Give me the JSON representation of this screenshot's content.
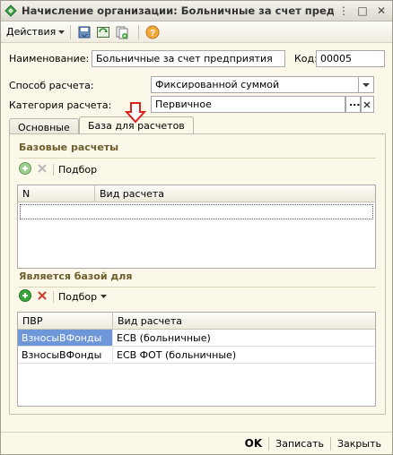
{
  "window": {
    "title": "Начисление организации: Больничные за счет предприя",
    "controls": [
      "⋮",
      "□",
      "✕"
    ]
  },
  "toolbar": {
    "actions_label": "Действия",
    "icons": [
      "save-and-close-icon",
      "refresh-icon",
      "copy-icon",
      "help-icon"
    ]
  },
  "form": {
    "name_label": "Наименование:",
    "name_value": "Больничные за счет предприятия",
    "code_label": "Код:",
    "code_value": "00005",
    "method_label": "Способ расчета:",
    "method_value": "Фиксированной суммой",
    "category_label": "Категория расчета:",
    "category_value": "Первичное"
  },
  "tabs": [
    {
      "label": "Основные",
      "active": false
    },
    {
      "label": "База для расчетов",
      "active": true
    }
  ],
  "base_section": {
    "title": "Базовые расчеты",
    "select_label": "Подбор",
    "columns": [
      "N",
      "Вид расчета"
    ],
    "rows": []
  },
  "is_base_section": {
    "title": "Является базой для",
    "select_label": "Подбор",
    "columns": [
      "ПВР",
      "Вид расчета"
    ],
    "rows": [
      {
        "pvr": "ВзносыВФонды",
        "kind": "ЕСВ (больничные)"
      },
      {
        "pvr": "ВзносыВФонды",
        "kind": "ЕСВ ФОТ (больничные)"
      }
    ]
  },
  "footer": {
    "ok_label": "OK",
    "save_label": "Записать",
    "close_label": "Закрыть"
  },
  "colors": {
    "accent_arrow": "#e0201a",
    "section_title": "#6b5e2c",
    "selection": "#6d97d9",
    "add_icon": "#3aa63a",
    "delete_icon": "#d23a2a"
  }
}
